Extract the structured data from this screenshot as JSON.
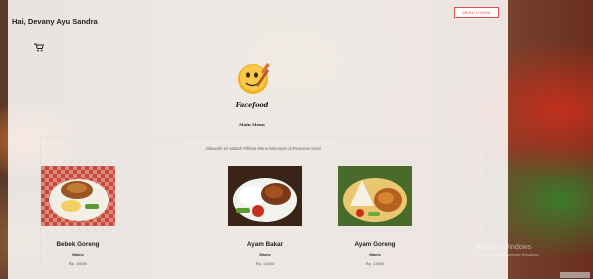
{
  "header": {
    "greeting": "Hai, Devany Ayu Sandra",
    "menu_button": "MENU UTAMA"
  },
  "brand": {
    "logo_text": "Facefood",
    "page_title": "Main Menu"
  },
  "menu": {
    "intro": "Dibawah ini adalah Pilihan Menu Minuman di Restoran Kami",
    "items": [
      {
        "name": "Ayam Bakar",
        "category": "Manis",
        "price": "Rp. 12000"
      },
      {
        "name": "Ayam Goreng",
        "category": "Manis",
        "price": "Rp. 12000"
      },
      {
        "name": "Bebek Goreng",
        "category": "Manis",
        "price": "Rp. 15000"
      }
    ]
  },
  "watermark": {
    "title": "Activate Windows",
    "subtitle": "Go to Settings to activate Windows."
  },
  "icons": {
    "cart": "cart-icon",
    "logo": "smiley-chef-icon"
  },
  "colors": {
    "accent": "#d9534f"
  }
}
